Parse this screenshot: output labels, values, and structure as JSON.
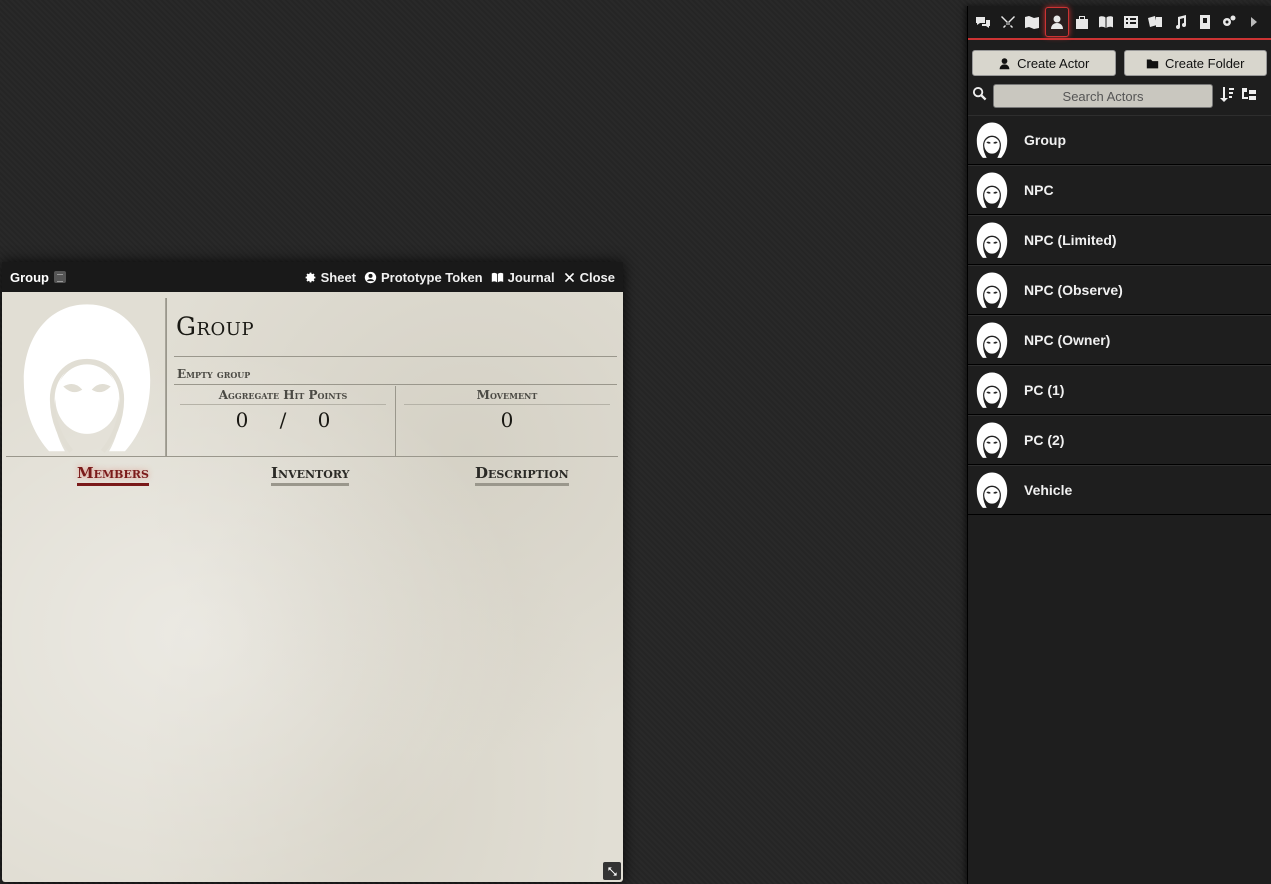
{
  "sheet": {
    "window_title": "Group",
    "header_buttons": {
      "sheet": "Sheet",
      "prototype_token": "Prototype Token",
      "journal": "Journal",
      "close": "Close"
    },
    "actor_name": "Group",
    "subtitle": "Empty group",
    "aggregate_hp": {
      "label": "Aggregate Hit Points",
      "current": "0",
      "separator": "/",
      "max": "0"
    },
    "movement": {
      "label": "Movement",
      "value": "0"
    },
    "tabs": [
      {
        "label": "Members",
        "active": true
      },
      {
        "label": "Inventory",
        "active": false
      },
      {
        "label": "Description",
        "active": false
      }
    ]
  },
  "sidebar": {
    "tabs": [
      {
        "icon": "chat-icon"
      },
      {
        "icon": "combat-icon"
      },
      {
        "icon": "scenes-icon"
      },
      {
        "icon": "actors-icon",
        "active": true
      },
      {
        "icon": "items-icon"
      },
      {
        "icon": "journal-icon"
      },
      {
        "icon": "tables-icon"
      },
      {
        "icon": "cards-icon"
      },
      {
        "icon": "playlists-icon"
      },
      {
        "icon": "compendium-icon"
      },
      {
        "icon": "settings-icon"
      },
      {
        "icon": "collapse-icon"
      }
    ],
    "create_actor": "Create Actor",
    "create_folder": "Create Folder",
    "search_placeholder": "Search Actors",
    "actors": [
      {
        "name": "Group"
      },
      {
        "name": "NPC"
      },
      {
        "name": "NPC (Limited)"
      },
      {
        "name": "NPC (Observe)"
      },
      {
        "name": "NPC (Owner)"
      },
      {
        "name": "PC (1)"
      },
      {
        "name": "PC (2)"
      },
      {
        "name": "Vehicle"
      }
    ]
  },
  "colors": {
    "accent": "#cc3333",
    "parchment": "#e1ded4",
    "active_tab": "#7a1a1a"
  }
}
